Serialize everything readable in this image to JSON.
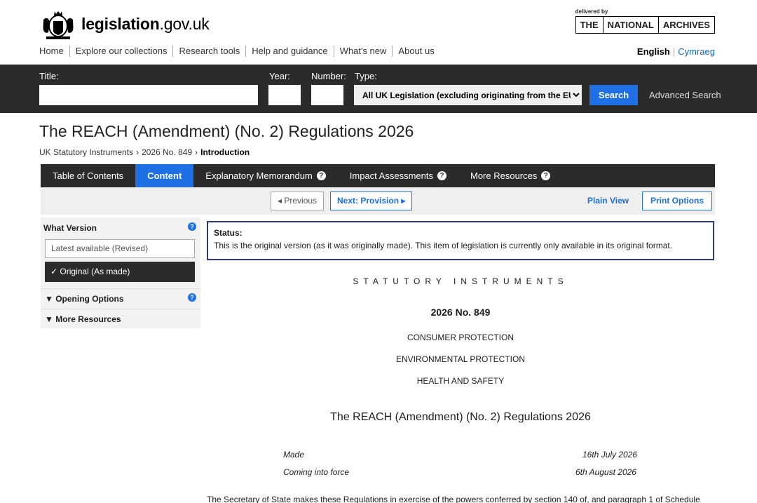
{
  "header": {
    "site_bold": "legislation",
    "site_rest": ".gov.uk",
    "delivered_by": "delivered by",
    "tna": [
      "THE",
      "NATIONAL",
      "ARCHIVES"
    ]
  },
  "topnav": [
    "Home",
    "Explore our collections",
    "Research tools",
    "Help and guidance",
    "What's new",
    "About us"
  ],
  "lang": {
    "english": "English",
    "welsh": "Cymraeg"
  },
  "search": {
    "title_label": "Title:",
    "year_label": "Year:",
    "number_label": "Number:",
    "type_label": "Type:",
    "type_value": "All UK Legislation (excluding originating from the EU)",
    "search_button": "Search",
    "advanced": "Advanced Search"
  },
  "page": {
    "title": "The REACH (Amendment) (No. 2) Regulations 2026",
    "breadcrumb": [
      "UK Statutory Instruments",
      "2026 No. 849",
      "Introduction"
    ]
  },
  "tabs": [
    {
      "label": "Table of Contents",
      "help": false
    },
    {
      "label": "Content",
      "help": false
    },
    {
      "label": "Explanatory Memorandum",
      "help": true
    },
    {
      "label": "Impact Assessments",
      "help": true
    },
    {
      "label": "More Resources",
      "help": true
    }
  ],
  "toolbar": {
    "previous": "Previous",
    "next": "Next: Provision",
    "plain_view": "Plain View",
    "print_options": "Print Options"
  },
  "sidebar": {
    "what_version": "What Version",
    "latest": "Latest available (Revised)",
    "original": "✓ Original (As made)",
    "opening_options": "▼ Opening Options",
    "more_resources": "▼ More Resources"
  },
  "status": {
    "label": "Status:",
    "text": "This is the original version (as it was originally made). This item of legislation is currently only available in its original format."
  },
  "doc": {
    "type": "STATUTORY INSTRUMENTS",
    "number": "2026 No. 849",
    "subjects": [
      "CONSUMER PROTECTION",
      "ENVIRONMENTAL PROTECTION",
      "HEALTH AND SAFETY"
    ],
    "title": "The REACH (Amendment) (No. 2) Regulations 2026",
    "made_label": "Made",
    "made_date": "16th July 2026",
    "force_label": "Coming into force",
    "force_date": "6th August 2026",
    "preamble": "The Secretary of State makes these Regulations in exercise of the powers conferred by section 140 of, and paragraph 1 of Schedule"
  }
}
